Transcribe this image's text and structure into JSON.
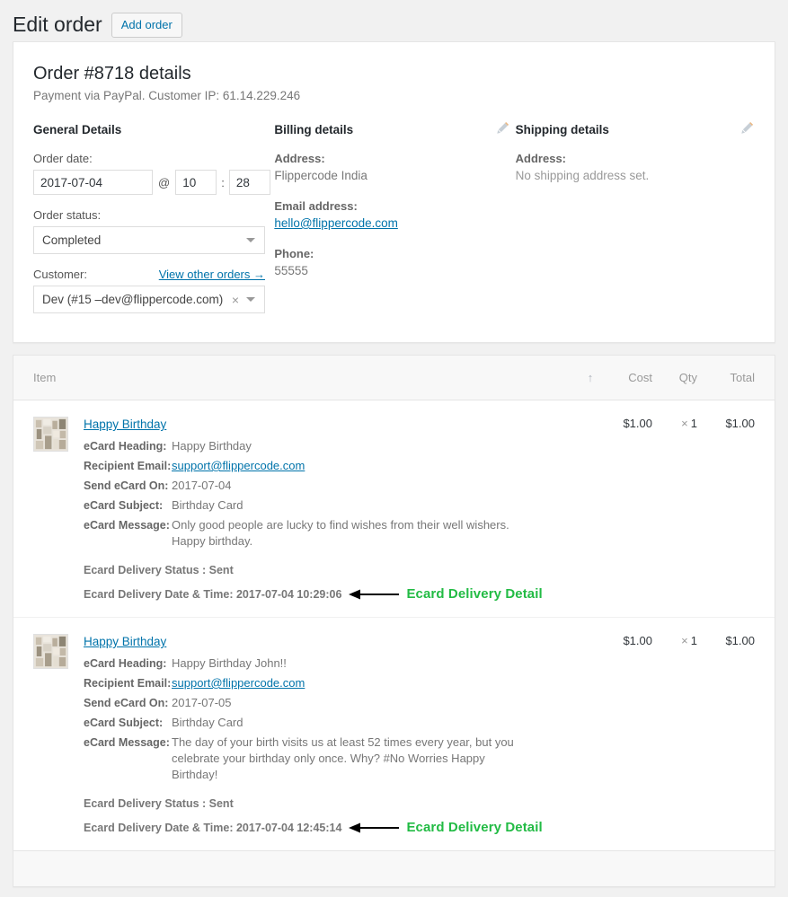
{
  "header": {
    "title": "Edit order",
    "add_order_label": "Add order"
  },
  "order": {
    "title": "Order #8718 details",
    "subtitle": "Payment via PayPal. Customer IP: 61.14.229.246"
  },
  "general": {
    "heading": "General Details",
    "order_date_label": "Order date:",
    "order_date_value": "2017-07-04",
    "at_symbol": "@",
    "hour_value": "10",
    "colon": ":",
    "minute_value": "28",
    "order_status_label": "Order status:",
    "order_status_value": "Completed",
    "customer_label": "Customer:",
    "view_other_orders": "View other orders →",
    "customer_value": "Dev (#15 –dev@flippercode.com)",
    "clear_glyph": "×"
  },
  "billing": {
    "heading": "Billing details",
    "address_label": "Address:",
    "address_value": "Flippercode India",
    "email_label": "Email address:",
    "email_value": "hello@flippercode.com",
    "phone_label": "Phone:",
    "phone_value": "55555"
  },
  "shipping": {
    "heading": "Shipping details",
    "address_label": "Address:",
    "address_value": "No shipping address set."
  },
  "items_table": {
    "columns": {
      "item": "Item",
      "sort": "↑",
      "cost": "Cost",
      "qty": "Qty",
      "total": "Total"
    },
    "rows": [
      {
        "name": "Happy Birthday",
        "cost": "$1.00",
        "qty_times": "×",
        "qty": "1",
        "total": "$1.00",
        "meta": [
          {
            "key": "eCard Heading:",
            "value": "Happy Birthday",
            "is_link": false
          },
          {
            "key": "Recipient Email:",
            "value": "support@flippercode.com",
            "is_link": true
          },
          {
            "key": "Send eCard On:",
            "value": "2017-07-04",
            "is_link": false
          },
          {
            "key": "eCard Subject:",
            "value": "Birthday Card",
            "is_link": false
          },
          {
            "key": "eCard Message:",
            "value": "Only good people are lucky to find wishes from their well wishers. Happy birthday.",
            "is_link": false
          }
        ],
        "delivery_status": "Ecard Delivery Status : Sent",
        "delivery_datetime": "Ecard Delivery Date & Time: 2017-07-04 10:29:06",
        "annotation": "Ecard Delivery Detail"
      },
      {
        "name": "Happy Birthday",
        "cost": "$1.00",
        "qty_times": "×",
        "qty": "1",
        "total": "$1.00",
        "meta": [
          {
            "key": "eCard Heading:",
            "value": "Happy Birthday John!!",
            "is_link": false
          },
          {
            "key": "Recipient Email:",
            "value": "support@flippercode.com",
            "is_link": true
          },
          {
            "key": "Send eCard On:",
            "value": "2017-07-05",
            "is_link": false
          },
          {
            "key": "eCard Subject:",
            "value": "Birthday Card",
            "is_link": false
          },
          {
            "key": "eCard Message:",
            "value": "The day of your birth visits us at least 52 times every year, but you celebrate your birthday only once. Why? #No Worries Happy Birthday!",
            "is_link": false
          }
        ],
        "delivery_status": "Ecard Delivery Status : Sent",
        "delivery_datetime": "Ecard Delivery Date & Time: 2017-07-04 12:45:14",
        "annotation": "Ecard Delivery Detail"
      }
    ]
  },
  "colors": {
    "annotation_green": "#22bb44",
    "link_blue": "#0073aa",
    "page_bg": "#f1f1f1",
    "panel_bg": "#ffffff"
  }
}
